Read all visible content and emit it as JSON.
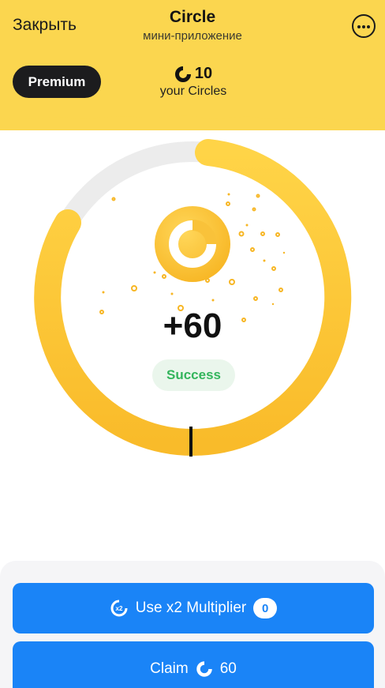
{
  "header": {
    "close_label": "Закрыть",
    "title": "Circle",
    "subtitle": "мини-приложение",
    "premium_label": "Premium",
    "balance_value": "10",
    "balance_label": "your Circles",
    "more_icon": "more-horizontal-circle-icon",
    "coin_icon": "circle-coin-icon",
    "background_color": "#fbd64f"
  },
  "result": {
    "amount": "+60",
    "status": "Success",
    "status_color": "#33b55c",
    "ring_color": "#ffc531",
    "ring_track_color": "#ececec"
  },
  "actions": {
    "multiplier_label": "Use x2 Multiplier",
    "multiplier_icon_text": "x2",
    "multiplier_count": "0",
    "claim_label": "Claim",
    "claim_amount": "60",
    "button_color": "#1a84f7"
  }
}
